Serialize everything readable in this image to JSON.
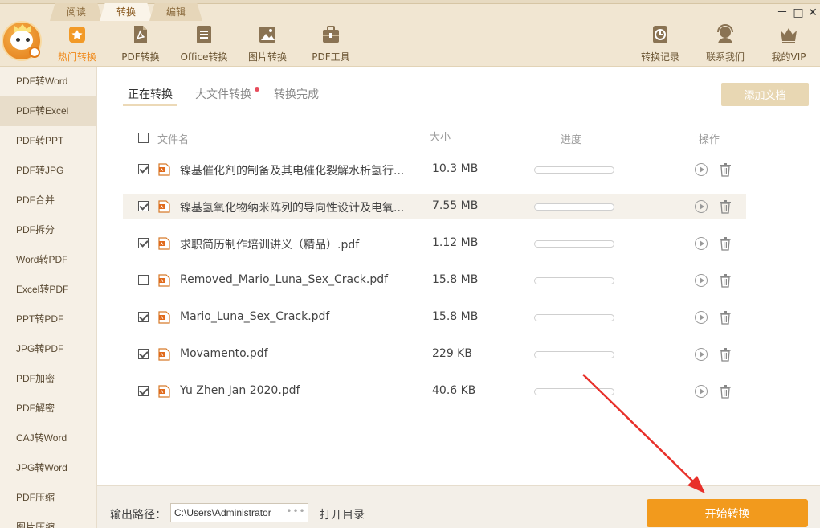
{
  "tabs": [
    "阅读",
    "转换",
    "编辑"
  ],
  "active_tab": 1,
  "toolbar": [
    {
      "label": "热门转换",
      "icon": "star-icon"
    },
    {
      "label": "PDF转换",
      "icon": "pdf-icon"
    },
    {
      "label": "Office转换",
      "icon": "document-icon"
    },
    {
      "label": "图片转换",
      "icon": "image-icon"
    },
    {
      "label": "PDF工具",
      "icon": "toolbox-icon"
    }
  ],
  "toolbar_right": [
    {
      "label": "转换记录",
      "icon": "history-clock-icon"
    },
    {
      "label": "联系我们",
      "icon": "headset-icon"
    },
    {
      "label": "我的VIP",
      "icon": "crown-icon"
    }
  ],
  "window_controls": {
    "minimize": "－",
    "maximize": "□",
    "close": "✕"
  },
  "sidebar": [
    "PDF转Word",
    "PDF转Excel",
    "PDF转PPT",
    "PDF转JPG",
    "PDF合并",
    "PDF拆分",
    "Word转PDF",
    "Excel转PDF",
    "PPT转PDF",
    "JPG转PDF",
    "PDF加密",
    "PDF解密",
    "CAJ转Word",
    "JPG转Word",
    "PDF压缩",
    "图片压缩"
  ],
  "sidebar_active": 1,
  "subtabs": [
    "正在转换",
    "大文件转换",
    "转换完成"
  ],
  "add_button": "添加文档",
  "table_header": {
    "name": "文件名",
    "size": "大小",
    "progress": "进度",
    "action": "操作"
  },
  "files": [
    {
      "name": "镍基催化剂的制备及其电催化裂解水析氢行...",
      "size": "10.3 MB",
      "checked": true,
      "progress": 0
    },
    {
      "name": "镍基氢氧化物纳米阵列的导向性设计及电氧...",
      "size": "7.55 MB",
      "checked": true,
      "progress": 0
    },
    {
      "name": "求职简历制作培训讲义（精品）.pdf",
      "size": "1.12 MB",
      "checked": true,
      "progress": 0
    },
    {
      "name": "Removed_Mario_Luna_Sex_Crack.pdf",
      "size": "15.8 MB",
      "checked": false,
      "progress": 0
    },
    {
      "name": "Mario_Luna_Sex_Crack.pdf",
      "size": "15.8 MB",
      "checked": true,
      "progress": 0
    },
    {
      "name": "Movamento.pdf",
      "size": "229 KB",
      "checked": true,
      "progress": 0
    },
    {
      "name": "Yu Zhen Jan 2020.pdf",
      "size": "40.6 KB",
      "checked": true,
      "progress": 0
    }
  ],
  "bottom": {
    "output_label": "输出路径：",
    "output_path": "C:\\Users\\Administrator",
    "browse": "•••",
    "open_dir": "打开目录",
    "start": "开始转换"
  },
  "colors": {
    "accent": "#f29a1d",
    "top_bg": "#f1e6d2",
    "sidebar_bg": "#f6f0e6",
    "annotation_arrow": "#e8302a"
  }
}
